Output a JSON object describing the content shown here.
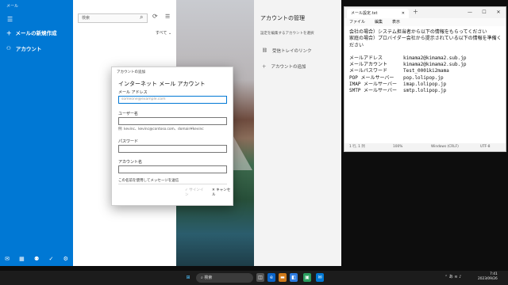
{
  "mail": {
    "app_title": "メール",
    "new_mail": "メールの新規作成",
    "accounts": "アカウント",
    "search_placeholder": "検索",
    "filter": "すべて ⌄",
    "account_panel": {
      "title": "アカウントの管理",
      "description": "設定を編集するアカウントを選択",
      "link_inbox": "受信トレイのリンク",
      "add_account": "アカウントの追加"
    }
  },
  "dialog": {
    "caption": "アカウントの追加",
    "heading": "インターネット メール アカウント",
    "email_label": "メール アドレス",
    "email_placeholder": "someone@example.com",
    "username_label": "ユーザー名",
    "username_hint": "例: kevinc、kevinc@contoso.com、domain¥kevinc",
    "password_label": "パスワード",
    "account_name_label": "アカウント名",
    "send_as": "この名前を使用してメッセージを送信",
    "signin": "✓ サインイン",
    "cancel": "✕ キャンセル"
  },
  "notepad": {
    "tab_title": "メール設定.txt",
    "menu": [
      "ファイル",
      "編集",
      "表示"
    ],
    "intro": [
      "会社の場合）システム担当者から以下の情報をもらってください",
      "家庭の場合）プロバイダー会社から提示されている以下の情報を準備ください"
    ],
    "rows": [
      {
        "key": "メールアドレス",
        "value": "kimama2@kimama2.sub.jp"
      },
      {
        "key": "メールアカウント",
        "value": "kimama2@kimama2.sub.jp"
      },
      {
        "key": "メールパスワード",
        "value": "Test_0001ki2mama"
      },
      {
        "key": "POP  メールサーバー",
        "value": "pop.lolipop.jp"
      },
      {
        "key": "IMAP メールサーバー",
        "value": "imap.lolipop.jp"
      },
      {
        "key": "SMTP メールサーバー",
        "value": "smtp.lolipop.jp"
      }
    ],
    "status": {
      "position": "1 行, 1 列",
      "zoom": "100%",
      "line_ending": "Windows (CRLF)",
      "encoding": "UTF-8"
    }
  },
  "taskbar": {
    "search": "検索",
    "time": "7:41",
    "date": "2023/09/26",
    "lang": "あ"
  }
}
